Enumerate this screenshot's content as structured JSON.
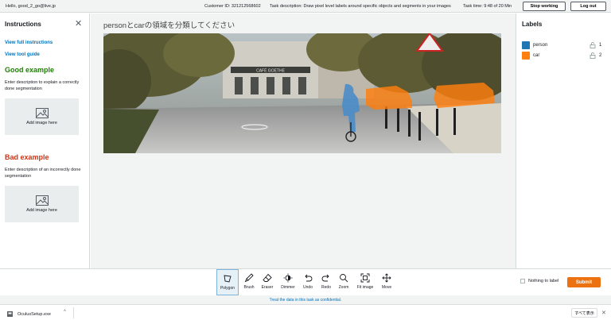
{
  "header": {
    "hello": "Hello, good_2_go@live.jp",
    "customer_id": "Customer ID: 321212568602",
    "task_description": "Task description: Draw pixel level labels around specific objects and segments in your images",
    "task_time": "Task time: 9:48 of 20 Min",
    "stop_label": "Stop working",
    "logout_label": "Log out"
  },
  "instructions": {
    "title": "Instructions",
    "view_full": "View full instructions",
    "view_tool": "View tool guide",
    "good_title": "Good example",
    "good_desc": "Enter description to explain a correctly done segmentation",
    "good_add": "Add image here",
    "bad_title": "Bad example",
    "bad_desc": "Enter description of an incorrectly done segmentation",
    "bad_add": "Add image here"
  },
  "canvas": {
    "prompt": "personとcarの領域を分類してください",
    "sign_text": "CAFÉ GOETHE"
  },
  "labels": {
    "title": "Labels",
    "items": [
      {
        "name": "person",
        "color": "#1f77b4",
        "key": "1"
      },
      {
        "name": "car",
        "color": "#ff7f0e",
        "key": "2"
      }
    ]
  },
  "tools": {
    "items": [
      {
        "label": "Polygon",
        "icon": "polygon-icon",
        "active": true
      },
      {
        "label": "Brush",
        "icon": "brush-icon"
      },
      {
        "label": "Eraser",
        "icon": "eraser-icon"
      },
      {
        "label": "Dimmer",
        "icon": "dimmer-icon"
      },
      {
        "label": "Undo",
        "icon": "undo-icon"
      },
      {
        "label": "Redo",
        "icon": "redo-icon"
      },
      {
        "label": "Zoom",
        "icon": "zoom-icon"
      },
      {
        "label": "Fit image",
        "icon": "fit-image-icon"
      },
      {
        "label": "Move",
        "icon": "move-icon"
      }
    ],
    "nothing_label": "Nothing to label",
    "submit_label": "Submit"
  },
  "footer": {
    "notice": "Treat the data in this task as confidential."
  },
  "download_bar": {
    "file_name": "OculusSetup.exe",
    "show_all": "すべて表示"
  },
  "colors": {
    "person": "#1f77b4",
    "car": "#ff7f0e",
    "submit": "#ec7211",
    "link": "#0073bb"
  }
}
